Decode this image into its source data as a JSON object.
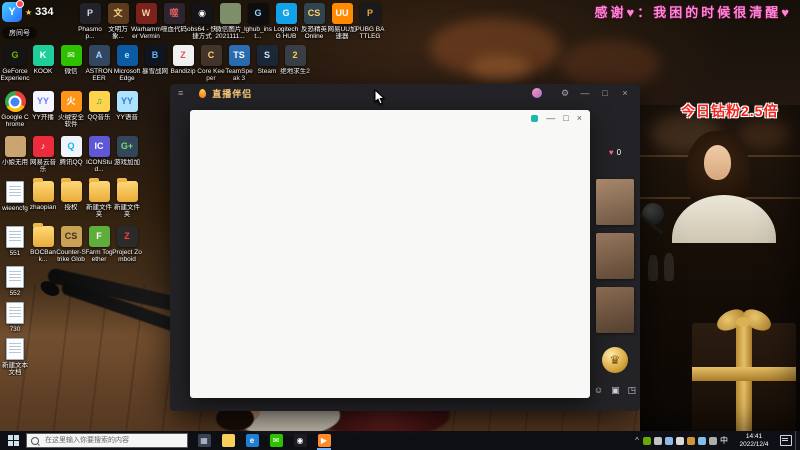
{
  "overlay": {
    "room": {
      "logo_glyph": "Y",
      "star": "★",
      "number": "334",
      "label": "房间号"
    },
    "thanks_message": "感谢♥：我困的时候很清醒♥",
    "diamond_banner": "今日钻粉2.5倍",
    "likes": "0",
    "colors": {
      "banner_red": "#f5231d",
      "message_pink": "#ff85d6",
      "ribbon_gold": "#d7ab55"
    }
  },
  "window": {
    "title": "直播伴侣",
    "controls": {
      "menu": "≡",
      "settings": "⚙",
      "min": "—",
      "max": "□",
      "close": "×"
    },
    "dialog_controls": {
      "min": "—",
      "max": "□",
      "close": "×"
    },
    "panel": {
      "heart": "♥",
      "emblem_glyph": "♛",
      "photos": [
        {
          "bg": "linear-gradient(165deg,#a8886c,#6f5743)"
        },
        {
          "bg": "linear-gradient(165deg,#97765d,#5f4936)"
        },
        {
          "bg": "linear-gradient(165deg,#8a6a52,#52402f)"
        }
      ],
      "tools": [
        {
          "g": "☺"
        },
        {
          "g": "▣"
        },
        {
          "g": "◳"
        }
      ]
    }
  },
  "desktop": {
    "row1": [
      {
        "label": "Phasmop...",
        "c": "#23222a",
        "g": "P",
        "gc": "#d8d8e0"
      },
      {
        "label": "文明万象...",
        "c": "#5b3a1e",
        "g": "文",
        "gc": "#ffd98a"
      },
      {
        "label": "Warhammer Vermint...",
        "c": "#7c221c",
        "g": "W",
        "gc": "#f3d7a3"
      },
      {
        "label": "噬血代码",
        "c": "#2c2530",
        "g": "噬",
        "gc": "#e06060"
      },
      {
        "label": "obs64 - 快捷方式",
        "c": "#141417",
        "g": "◉",
        "gc": "#ffffff"
      },
      {
        "label": "微信图片_2021111...",
        "c": "#7d8f6a",
        "g": "",
        "gc": ""
      },
      {
        "label": "lghub_inst...",
        "c": "#0d0d10",
        "g": "G",
        "gc": "#9ad0ff"
      },
      {
        "label": "Logitech G HUB",
        "c": "#12a2e8",
        "g": "G",
        "gc": "#ffffff"
      },
      {
        "label": "反恐精英Online",
        "c": "#31434f",
        "g": "CS",
        "gc": "#ffd066"
      },
      {
        "label": "网易UU加速器",
        "c": "#ff8a00",
        "g": "UU",
        "gc": "#ffffff"
      },
      {
        "label": "PUBG BATTLEGR...",
        "c": "#1a1a1d",
        "g": "P",
        "gc": "#f2a33c"
      }
    ],
    "row2": [
      {
        "label": "GeForce Experience",
        "c": "#141414",
        "g": "G",
        "gc": "#76b900"
      },
      {
        "label": "KOOK",
        "c": "#1ecf9a",
        "g": "K",
        "gc": "#ffffff"
      },
      {
        "label": "微信",
        "c": "#2dc100",
        "g": "✉",
        "gc": "#ffffff"
      },
      {
        "label": "ASTRONEER",
        "c": "#33465f",
        "g": "A",
        "gc": "#9fd4ff"
      },
      {
        "label": "Microsoft Edge",
        "c": "#0c59a4",
        "g": "e",
        "gc": "#9ff0e8"
      },
      {
        "label": "暴雪战网",
        "c": "#10161f",
        "g": "B",
        "gc": "#5fb3ff"
      },
      {
        "label": "Bandizip",
        "c": "#f2f2f2",
        "g": "Z",
        "gc": "#e2574c"
      },
      {
        "label": "Core Keeper",
        "c": "#43352a",
        "g": "C",
        "gc": "#ffd27a"
      },
      {
        "label": "TeamSpeak 3",
        "c": "#2a6db0",
        "g": "TS",
        "gc": "#ffffff"
      },
      {
        "label": "Steam",
        "c": "#1b2838",
        "g": "S",
        "gc": "#cfe6ff"
      },
      {
        "label": "绝地求生2",
        "c": "#3a3f47",
        "g": "2",
        "gc": "#ffcf3d"
      }
    ],
    "grid": [
      {
        "label": "Google Chrome",
        "shape": "chrome"
      },
      {
        "label": "YY开播",
        "c": "#f5f6ff",
        "g": "YY",
        "gc": "#6b7bff"
      },
      {
        "label": "火绒安全软件",
        "c": "#ff9518",
        "g": "火",
        "gc": "#ffffff"
      },
      {
        "label": "QQ音乐",
        "c": "#ffd34d",
        "g": "♫",
        "gc": "#1faf3a"
      },
      {
        "label": "YY语音",
        "c": "#aee2ff",
        "g": "YY",
        "gc": "#2b7bd4"
      },
      {
        "label": "小娘无用",
        "c": "#caa571",
        "g": "",
        "gc": ""
      },
      {
        "label": "网易云音乐",
        "c": "#ec2b3c",
        "g": "♪",
        "gc": "#ffffff"
      },
      {
        "label": "腾讯QQ",
        "c": "#eef4fa",
        "g": "Q",
        "gc": "#10b3f0"
      },
      {
        "label": "ICONStud...",
        "c": "#5e57d6",
        "g": "IC",
        "gc": "#ffffff"
      },
      {
        "label": "游戏加加",
        "c": "#33475c",
        "g": "G+",
        "gc": "#7ddb6e"
      },
      {
        "label": "wieencfg",
        "shape": "file"
      },
      {
        "label": "zhaopian",
        "shape": "folder"
      },
      {
        "label": "授权",
        "shape": "folder"
      },
      {
        "label": "新建文件夹",
        "shape": "folder"
      },
      {
        "label": "新建文件夹",
        "shape": "folder"
      },
      {
        "label": "551",
        "shape": "file"
      },
      {
        "label": "BOCBank...",
        "shape": "folder"
      },
      {
        "label": "Counter-Strike Global Off...",
        "c": "#caa257",
        "g": "CS",
        "gc": "#3b2f1d"
      },
      {
        "label": "Farm Together",
        "c": "#5fae3c",
        "g": "F",
        "gc": "#ffffff"
      },
      {
        "label": "Project Zomboid",
        "c": "#2b2b2b",
        "g": "Z",
        "gc": "#ff4136"
      }
    ],
    "extras": [
      {
        "label": "552",
        "shape": "file"
      },
      {
        "label": "730",
        "shape": "file"
      },
      {
        "label": "新建文本文档",
        "shape": "file"
      }
    ]
  },
  "taskbar": {
    "search_placeholder": "在这里输入你要搜索的内容",
    "apps": [
      {
        "name": "task-view",
        "c": "#3a4150",
        "g": "▦",
        "gc": "#cfd8e6"
      },
      {
        "name": "file-explorer",
        "c": "#f7cf5a",
        "g": "",
        "gc": ""
      },
      {
        "name": "edge",
        "c": "#1e7fd4",
        "g": "e",
        "gc": "#ffffff"
      },
      {
        "name": "wechat",
        "c": "#2dc100",
        "g": "✉",
        "gc": "#ffffff"
      },
      {
        "name": "obs",
        "c": "#1d1d21",
        "g": "◉",
        "gc": "#ffffff"
      },
      {
        "name": "streaming-companion",
        "c": "#ff8a2a",
        "g": "▶",
        "gc": "#ffffff",
        "active": true
      }
    ],
    "caret": "^",
    "tray_icons": [
      {
        "c": "#76b900"
      },
      {
        "c": "#d6d6d6"
      },
      {
        "c": "#9ecbff"
      },
      {
        "c": "#efefef"
      },
      {
        "c": "#e8a33c"
      },
      {
        "c": "#8fd3ff"
      },
      {
        "c": "#bfbfbf"
      }
    ],
    "ime": "中",
    "time": "14:41",
    "date": "2022/12/4"
  }
}
